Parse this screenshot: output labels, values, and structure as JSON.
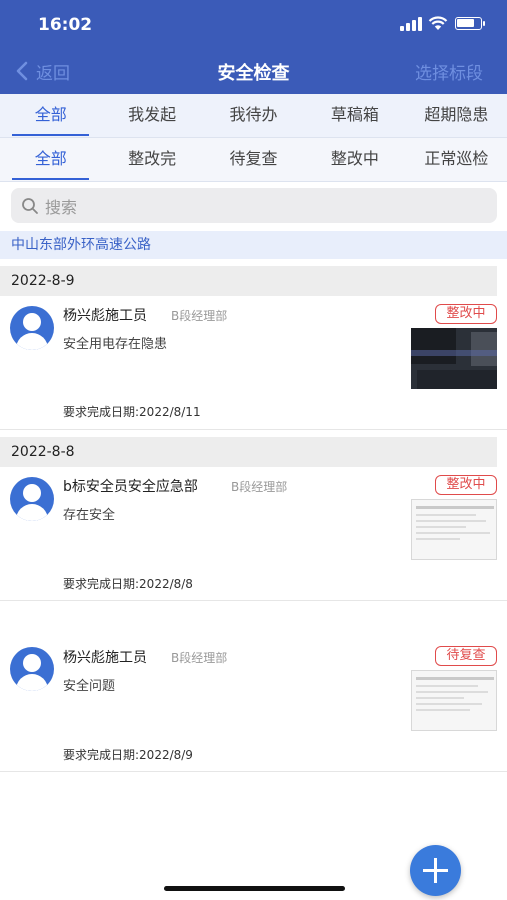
{
  "status_bar": {
    "time": "16:02"
  },
  "nav": {
    "back_label": "返回",
    "title": "安全检查",
    "right_action": "选择标段"
  },
  "tabs_primary": [
    {
      "label": "全部",
      "active": true
    },
    {
      "label": "我发起",
      "active": false
    },
    {
      "label": "我待办",
      "active": false
    },
    {
      "label": "草稿箱",
      "active": false
    },
    {
      "label": "超期隐患",
      "active": false
    }
  ],
  "tabs_secondary": [
    {
      "label": "全部",
      "active": true
    },
    {
      "label": "整改完",
      "active": false
    },
    {
      "label": "待复查",
      "active": false
    },
    {
      "label": "整改中",
      "active": false
    },
    {
      "label": "正常巡检",
      "active": false
    }
  ],
  "search": {
    "placeholder": "搜索"
  },
  "project": "中山东部外环高速公路",
  "groups": [
    {
      "date": "2022-8-9",
      "items": [
        {
          "name": "杨兴彪施工员",
          "dept": "B段经理部",
          "desc": "安全用电存在隐患",
          "status": "整改中",
          "due": "要求完成日期:2022/8/11"
        }
      ]
    },
    {
      "date": "2022-8-8",
      "items": [
        {
          "name": "b标安全员安全应急部",
          "dept": "B段经理部",
          "desc": "存在安全",
          "status": "整改中",
          "due": "要求完成日期:2022/8/8"
        },
        {
          "name": "杨兴彪施工员",
          "dept": "B段经理部",
          "desc": "安全问题",
          "status": "待复查",
          "due": "要求完成日期:2022/8/9"
        }
      ]
    }
  ],
  "colors": {
    "header": "#3b5bb8",
    "accent": "#3461d6",
    "badge": "#e04b4b",
    "fab": "#3a7bdc"
  },
  "icons": {
    "back": "chevron-left-icon",
    "search": "search-icon",
    "avatar": "user-avatar-icon",
    "fab": "plus-icon"
  }
}
